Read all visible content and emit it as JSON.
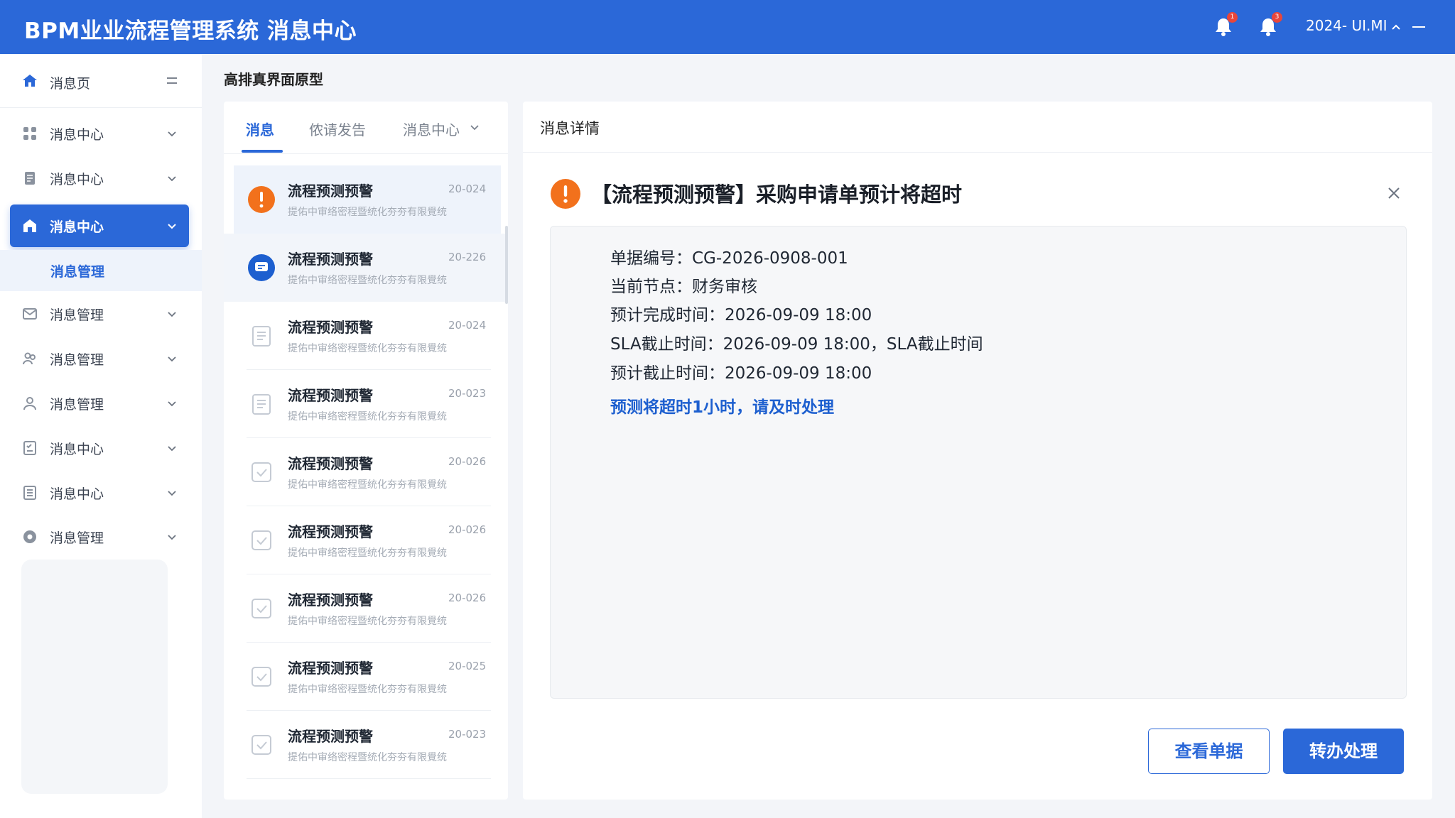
{
  "header": {
    "app_title": "BPM业业流程管理系统 消息中心",
    "bell1_badge": "1",
    "bell2_badge": "3",
    "user": "2024- UI.MI",
    "brand_color": "#2b68d8"
  },
  "sidebar": {
    "home_label": "消息页",
    "items": [
      {
        "label": "消息中心",
        "icon": "grid-icon"
      },
      {
        "label": "消息中心",
        "icon": "document-icon"
      },
      {
        "label": "消息中心",
        "icon": "home-icon",
        "active": true
      },
      {
        "label": "消息管理",
        "icon": "mail-icon"
      },
      {
        "label": "消息管理",
        "icon": "users-icon"
      },
      {
        "label": "消息管理",
        "icon": "user-icon"
      },
      {
        "label": "消息中心",
        "icon": "checklist-icon"
      },
      {
        "label": "消息中心",
        "icon": "list-icon"
      },
      {
        "label": "消息管理",
        "icon": "settings-icon"
      }
    ],
    "active_sub_item": "消息管理"
  },
  "page": {
    "title": "高排真界面原型"
  },
  "tabs": [
    {
      "label": "消息",
      "active": true
    },
    {
      "label": "侬请发告"
    },
    {
      "label": "消息中心"
    }
  ],
  "messages": [
    {
      "title": "流程预测预警",
      "date": "20-024",
      "summary": "提佑中审络密程暨统化夯夯有限覺统",
      "icon": "warning-icon",
      "state": "selected"
    },
    {
      "title": "流程预测预警",
      "date": "20-226",
      "summary": "提佑中审络密程暨统化夯夯有限覺统",
      "icon": "message-icon",
      "state": "hover"
    },
    {
      "title": "流程预测预警",
      "date": "20-024",
      "summary": "提佑中审络密程暨统化夯夯有限覺统",
      "icon": "document-icon"
    },
    {
      "title": "流程预测预警",
      "date": "20-023",
      "summary": "提佑中审络密程暨统化夯夯有限覺统",
      "icon": "document-icon"
    },
    {
      "title": "流程预测预警",
      "date": "20-026",
      "summary": "提佑中审络密程暨统化夯夯有限覺统",
      "icon": "check-icon"
    },
    {
      "title": "流程预测预警",
      "date": "20-026",
      "summary": "提佑中审络密程暨统化夯夯有限覺统",
      "icon": "check-icon"
    },
    {
      "title": "流程预测预警",
      "date": "20-026",
      "summary": "提佑中审络密程暨统化夯夯有限覺统",
      "icon": "check-icon"
    },
    {
      "title": "流程预测预警",
      "date": "20-025",
      "summary": "提佑中审络密程暨统化夯夯有限覺统",
      "icon": "check-icon"
    },
    {
      "title": "流程预测预警",
      "date": "20-023",
      "summary": "提佑中审络密程暨统化夯夯有限覺统",
      "icon": "check-icon"
    }
  ],
  "detail": {
    "panel_title": "消息详情",
    "title": "【流程预测预警】采购申请单预计将超时",
    "fields": [
      "单据编号：CG-2026-0908-001",
      "当前节点：财务审核",
      "预计完成时间：2026-09-09 18:00",
      "SLA截止时间：2026-09-09 18:00，SLA截止时间",
      "预计截止时间：2026-09-09 18:00"
    ],
    "alert_text": "预测将超时1小时，请及时处理",
    "view_button": "查看单据",
    "transfer_button": "转办处理",
    "warning_color": "#f2711c"
  }
}
